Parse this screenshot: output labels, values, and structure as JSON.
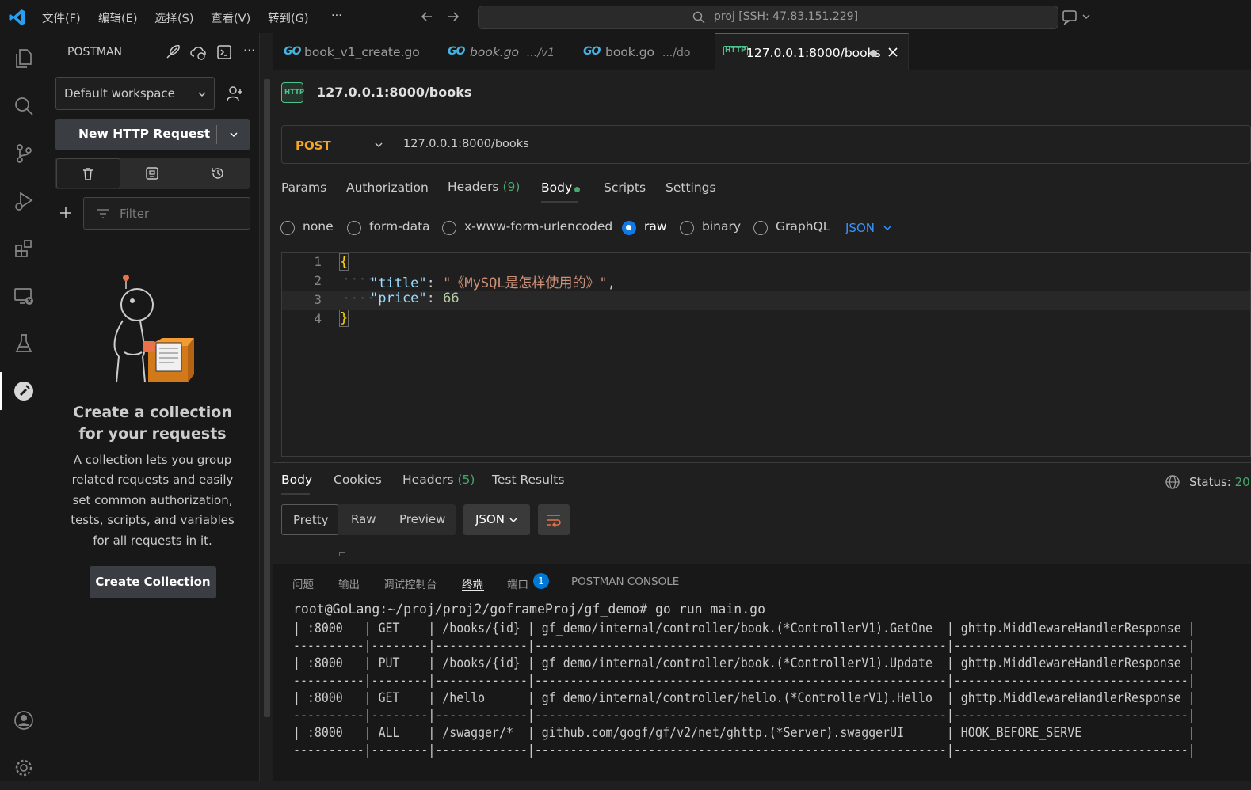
{
  "titlebar": {
    "menu": [
      "文件(F)",
      "编辑(E)",
      "选择(S)",
      "查看(V)",
      "转到(G)",
      "···"
    ],
    "search_text": "proj [SSH: 47.83.151.229]"
  },
  "activity": {
    "icons": [
      "explorer-icon",
      "search-icon",
      "source-control-icon",
      "run-debug-icon",
      "extensions-icon",
      "remote-explorer-icon",
      "testing-icon",
      "postman-icon",
      "accounts-icon",
      "settings-gear-icon"
    ]
  },
  "sidebar": {
    "title": "POSTMAN",
    "workspace": "Default workspace",
    "new_request": "New HTTP Request",
    "filter_placeholder": "Filter",
    "empty_title": "Create a collection for your requests",
    "empty_desc": "A collection lets you group related requests and easily set common authorization, tests, scripts, and variables for all requests in it.",
    "create_button": "Create Collection"
  },
  "tabs": [
    {
      "icon": "GO",
      "label": "book_v1_create.go",
      "desc": ""
    },
    {
      "icon": "GO",
      "label": "book.go",
      "desc": ".../v1"
    },
    {
      "icon": "GO",
      "label": "book.go",
      "desc": ".../do"
    },
    {
      "icon": "HTTP",
      "label": "127.0.0.1:8000/books",
      "desc": ""
    }
  ],
  "request": {
    "title": "127.0.0.1:8000/books",
    "method": "POST",
    "url": "127.0.0.1:8000/books",
    "tabs": [
      "Params",
      "Authorization",
      "Headers",
      "Body",
      "Scripts",
      "Settings"
    ],
    "headers_count": "(9)",
    "body_types": [
      "none",
      "form-data",
      "x-www-form-urlencoded",
      "raw",
      "binary",
      "GraphQL"
    ],
    "selected_body_type": "raw",
    "format": "JSON",
    "line_numbers": [
      "1",
      "2",
      "3",
      "4"
    ],
    "body_title_key": "\"title\"",
    "body_title_value": "\"《MySQL是怎样使用的》\"",
    "body_price_key": "\"price\"",
    "body_price_value": "66",
    "open_brace": "{",
    "close_brace": "}"
  },
  "response": {
    "tabs": [
      "Body",
      "Cookies",
      "Headers",
      "Test Results"
    ],
    "headers_count": "(5)",
    "status_label": "Status:",
    "status_value": "20",
    "views": [
      "Pretty",
      "Raw",
      "Preview"
    ],
    "format": "JSON"
  },
  "panel": {
    "tabs": [
      "问题",
      "输出",
      "调试控制台",
      "终端",
      "端口",
      "POSTMAN CONSOLE"
    ],
    "ports_badge": "1",
    "active_tab": "终端"
  },
  "terminal": {
    "lines": [
      "root@GoLang:~/proj/proj2/goframeProj/gf_demo# go run main.go",
      "| :8000   | GET    | /books/{id} | gf_demo/internal/controller/book.(*ControllerV1).GetOne  | ghttp.MiddlewareHandlerResponse |",
      "----------|--------|-------------|----------------------------------------------------------|---------------------------------|",
      "| :8000   | PUT    | /books/{id} | gf_demo/internal/controller/book.(*ControllerV1).Update  | ghttp.MiddlewareHandlerResponse |",
      "----------|--------|-------------|----------------------------------------------------------|---------------------------------|",
      "| :8000   | GET    | /hello      | gf_demo/internal/controller/hello.(*ControllerV1).Hello  | ghttp.MiddlewareHandlerResponse |",
      "----------|--------|-------------|----------------------------------------------------------|---------------------------------|",
      "| :8000   | ALL    | /swagger/*  | github.com/gogf/gf/v2/net/ghttp.(*Server).swaggerUI      | HOOK_BEFORE_SERVE               |",
      "----------|--------|-------------|----------------------------------------------------------|---------------------------------|"
    ]
  },
  "colors": {
    "accent": "#0078d4",
    "method_post": "#f5a623",
    "json_string": "#ce9178",
    "json_key": "#9cdcfe",
    "json_number": "#b5cea8",
    "count_green": "#49a66c"
  }
}
